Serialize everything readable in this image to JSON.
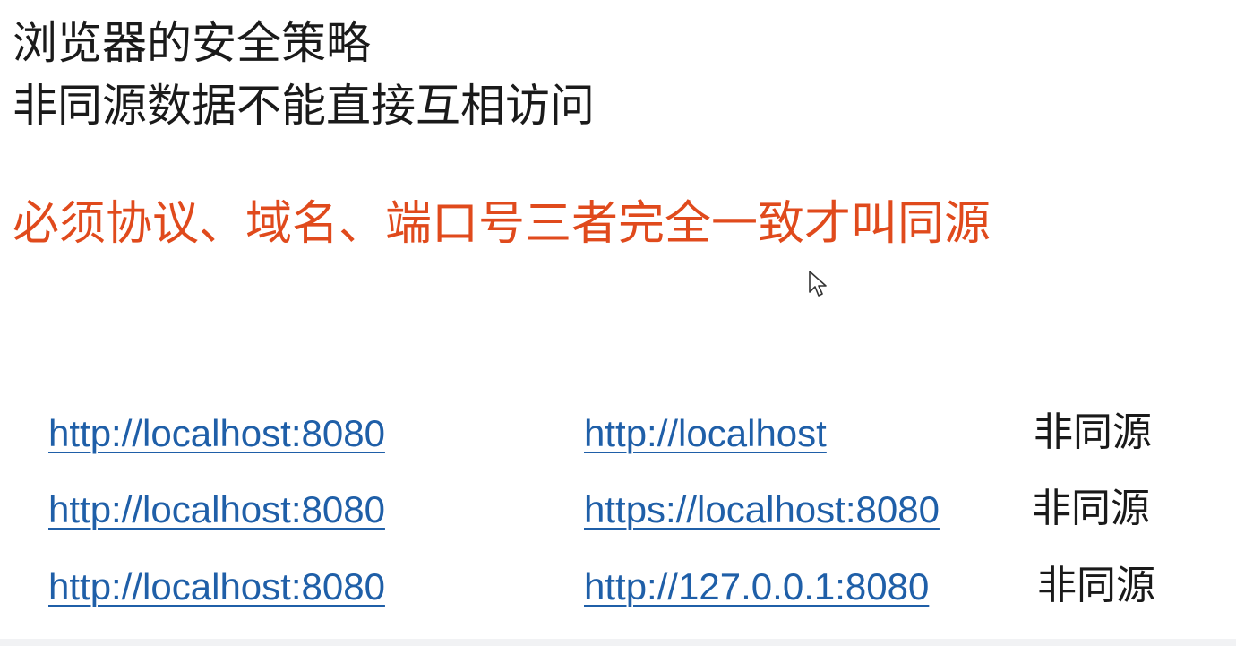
{
  "slide": {
    "title_line1": "浏览器的安全策略",
    "title_line2": "非同源数据不能直接互相访问",
    "rule": "必须协议、域名、端口号三者完全一致才叫同源",
    "rule_color": "#e04a1c",
    "link_color": "#1f5fa8",
    "examples": [
      {
        "url_a": "http://localhost:8080",
        "url_b": "http://localhost",
        "verdict": "非同源"
      },
      {
        "url_a": "http://localhost:8080",
        "url_b": "https://localhost:8080",
        "verdict": "非同源"
      },
      {
        "url_a": "http://localhost:8080",
        "url_b": "http://127.0.0.1:8080",
        "verdict": "非同源"
      }
    ]
  },
  "cursor_icon": "mouse-pointer-icon"
}
